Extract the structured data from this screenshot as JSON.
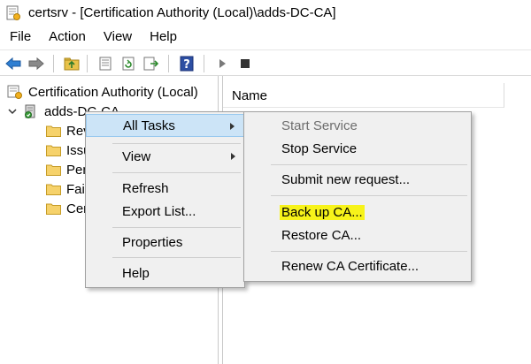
{
  "window": {
    "title": "certsrv - [Certification Authority (Local)\\adds-DC-CA]"
  },
  "menubar": {
    "items": [
      "File",
      "Action",
      "View",
      "Help"
    ]
  },
  "toolbar": {
    "buttons": [
      "back-icon",
      "forward-icon",
      "up-folder-icon",
      "properties-icon",
      "refresh-icon",
      "export-icon",
      "help-icon",
      "start-icon",
      "stop-icon"
    ]
  },
  "tree": {
    "root": "Certification Authority (Local)",
    "ca": "adds-DC-CA",
    "folders": [
      "Rev",
      "Issu",
      "Pen",
      "Fai",
      "Cer"
    ]
  },
  "list": {
    "column_name": "Name"
  },
  "context_menu": {
    "items": [
      "All Tasks",
      "View",
      "Refresh",
      "Export List...",
      "Properties",
      "Help"
    ]
  },
  "submenu": {
    "items": [
      "Start Service",
      "Stop Service",
      "Submit new request...",
      "Back up CA...",
      "Restore CA...",
      "Renew CA Certificate..."
    ]
  },
  "colors": {
    "highlight": "#cce4f7",
    "marker": "#f7f31a"
  }
}
